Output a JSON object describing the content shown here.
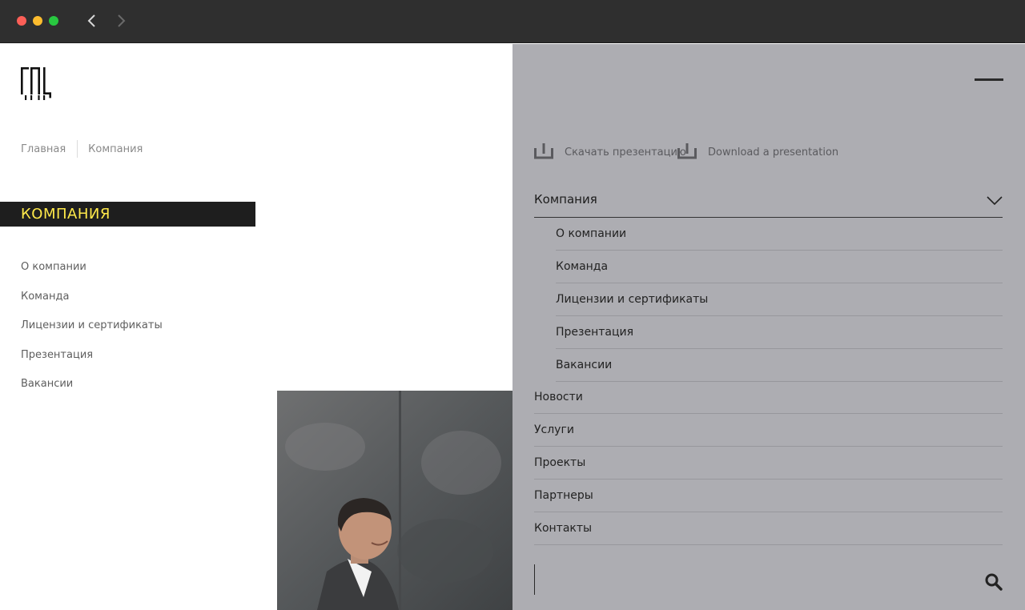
{
  "browser": {
    "back_icon": "chevron-left-icon",
    "forward_icon": "chevron-right-icon"
  },
  "logo": {
    "icon": "company-logo-mark"
  },
  "breadcrumb": {
    "items": [
      "Главная",
      "Компания"
    ]
  },
  "section": {
    "title": "КОМПАНИЯ"
  },
  "left_menu": {
    "items": [
      "О компании",
      "Команда",
      "Лицензии и сертификаты",
      "Презентация",
      "Вакансии"
    ]
  },
  "overlay": {
    "downloads": {
      "ru_label": "Скачать презентацию",
      "en_label": "Download a presentation",
      "icon": "download-icon"
    },
    "menu": {
      "expanded_label": "Компания",
      "sub_items": [
        "О компании",
        "Команда",
        "Лицензии и сертификаты",
        "Презентация",
        "Вакансии"
      ],
      "items": [
        "Новости",
        "Услуги",
        "Проекты",
        "Партнеры",
        "Контакты"
      ]
    },
    "search": {
      "placeholder": "",
      "icon": "search-icon"
    }
  },
  "colors": {
    "accent_yellow": "#ffe94a",
    "section_bar": "#1e1e1e",
    "overlay_bg": "#adadb2",
    "chrome_bg": "#2f2f2f"
  }
}
